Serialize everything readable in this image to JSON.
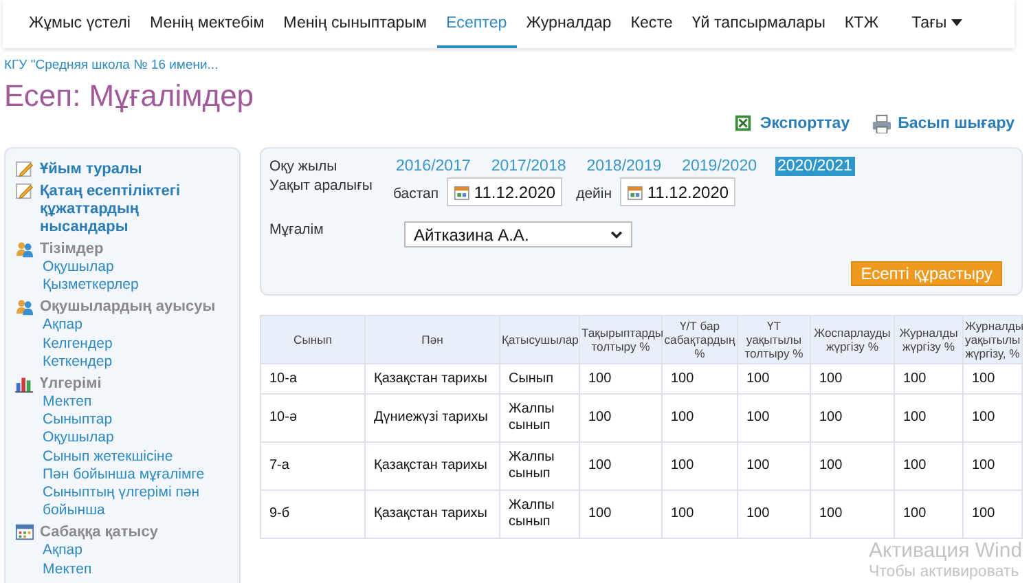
{
  "nav": {
    "items": [
      {
        "label": "Жұмыс үстелі",
        "selected": false
      },
      {
        "label": "Менің мектебім",
        "selected": false
      },
      {
        "label": "Менің сыныптарым",
        "selected": false
      },
      {
        "label": "Есептер",
        "selected": true
      },
      {
        "label": "Журналдар",
        "selected": false
      },
      {
        "label": "Кесте",
        "selected": false
      },
      {
        "label": "Үй тапсырмалары",
        "selected": false
      },
      {
        "label": "КТЖ",
        "selected": false
      }
    ],
    "more": "Тағы"
  },
  "breadcrumb": "КГУ \"Средняя школа № 16 имени...",
  "title": "Есеп: Мұғалімдер",
  "actions": [
    {
      "label": "Экспорттау",
      "kind": "excel"
    },
    {
      "label": "Басып шығару",
      "kind": "print"
    }
  ],
  "sidebar": {
    "sections": [
      {
        "label": "Ұйым туралы",
        "kind": "doc"
      },
      {
        "label": "Қатаң есептіліктегі құжаттардың нысандары",
        "kind": "doc"
      },
      {
        "label": "Тізімдер",
        "kind": "people",
        "children": [
          "Оқушылар",
          "Қызметкерлер"
        ]
      },
      {
        "label": "Оқушылардың ауысуы",
        "kind": "people",
        "children": [
          "Ақпар",
          "Келгендер",
          "Кеткендер"
        ]
      },
      {
        "label": "Үлгерімі",
        "kind": "chart",
        "children": [
          "Мектеп",
          "Сыныптар",
          "Оқушылар",
          "Сынып жетекшісіне",
          "Пән бойынша мұғалімге",
          "Сыныптың үлгерімі пән бойынша"
        ]
      },
      {
        "label": "Сабаққа қатысу",
        "kind": "grid",
        "children": [
          "Ақпар",
          "Мектеп"
        ]
      }
    ]
  },
  "filters": {
    "year_label": "Оқу жылы",
    "years": [
      {
        "label": "2016/2017",
        "selected": false
      },
      {
        "label": "2017/2018",
        "selected": false
      },
      {
        "label": "2018/2019",
        "selected": false
      },
      {
        "label": "2019/2020",
        "selected": false
      },
      {
        "label": "2020/2021",
        "selected": true
      }
    ],
    "period_label": "Уақыт аралығы",
    "from_label": "бастап",
    "from_value": "11.12.2020",
    "to_label": "дейін",
    "to_value": "11.12.2020",
    "teacher_label": "Мұғалім",
    "teacher_value": "Айтказина А.А.",
    "submit": "Есепті құрастыру"
  },
  "table": {
    "columns": [
      "Сынып",
      "Пән",
      "Қатысушылар",
      "Тақырыптарды толтыру %",
      "Ү/Т бар сабақтардың %",
      "ҮТ уақытылы толтыру %",
      "Жоспарлауды жүргізу %",
      "Журналды жүргізу %",
      "Журналды уақытылы жүргізу, %"
    ],
    "rows": [
      [
        "10-а",
        "Қазақстан тарихы",
        "Сынып",
        "100",
        "100",
        "100",
        "100",
        "100",
        "100"
      ],
      [
        "10-ә",
        "Дүниежүзі тарихы",
        "Жалпы сынып",
        "100",
        "100",
        "100",
        "100",
        "100",
        "100"
      ],
      [
        "7-а",
        "Қазақстан тарихы",
        "Жалпы сынып",
        "100",
        "100",
        "100",
        "100",
        "100",
        "100"
      ],
      [
        "9-б",
        "Қазақстан тарихы",
        "Жалпы сынып",
        "100",
        "100",
        "100",
        "100",
        "100",
        "100"
      ]
    ]
  },
  "overlay": {
    "title": "Активация Wind",
    "subtitle": "Чтобы активировать"
  }
}
